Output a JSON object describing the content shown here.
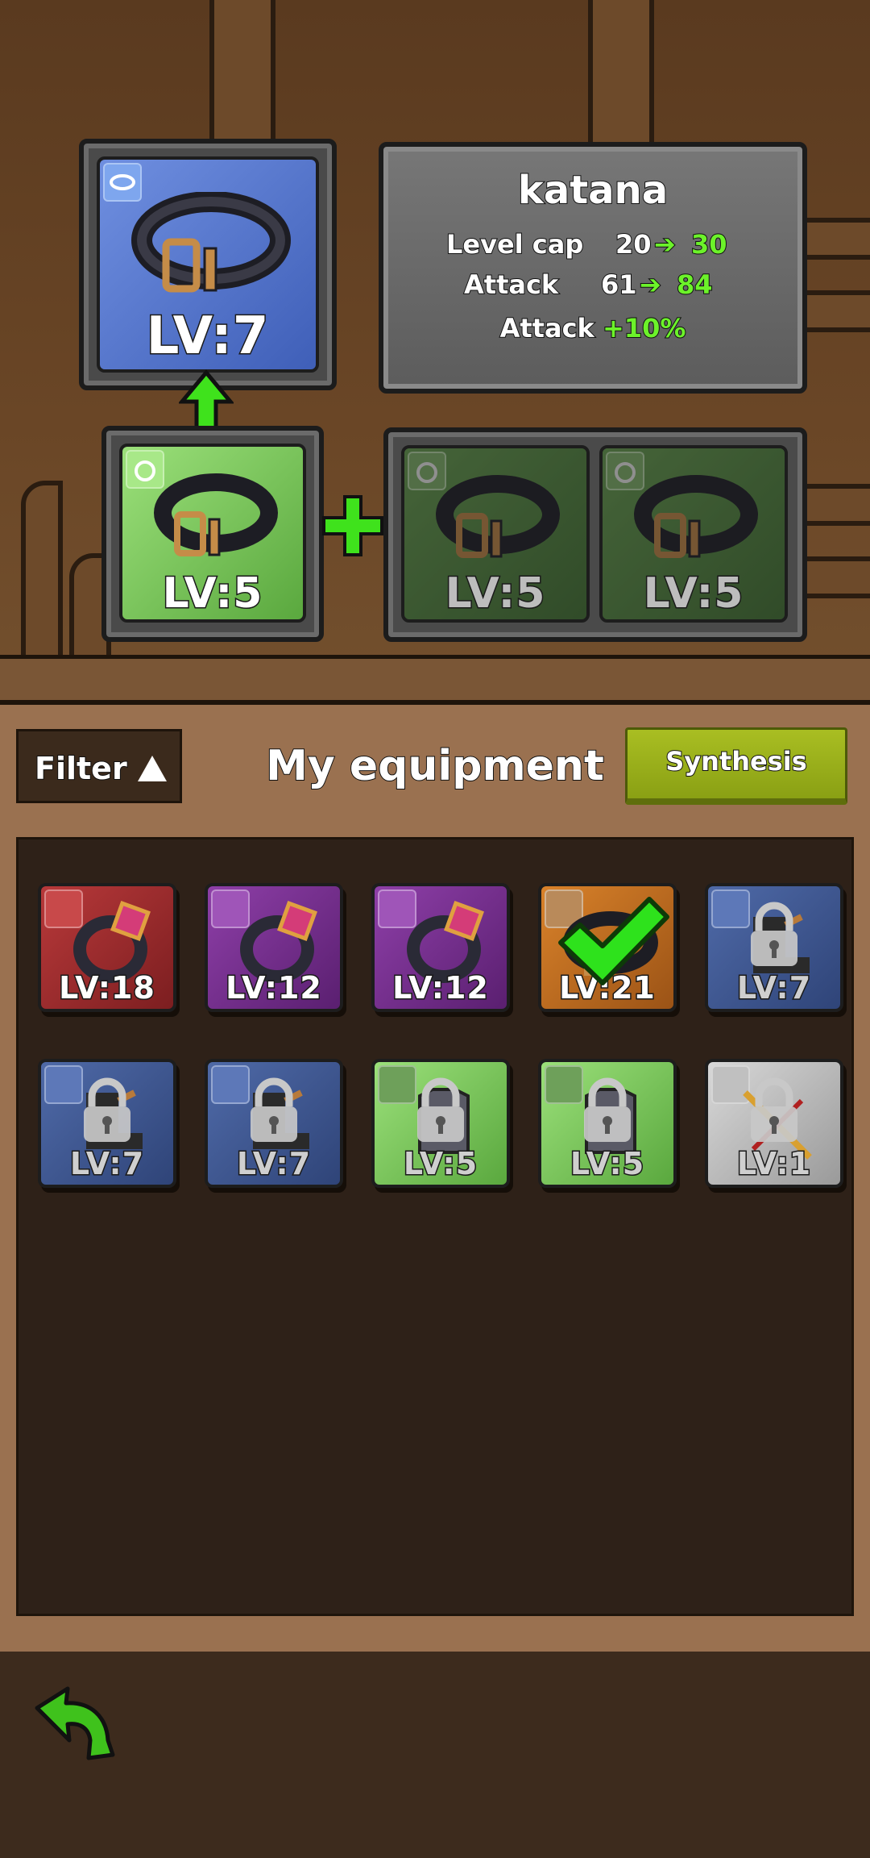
{
  "upgrade": {
    "target": {
      "level": "LV:7",
      "icon": "belt-icon",
      "slot_icon": "belt-slot-icon"
    },
    "source": {
      "level": "LV:5",
      "icon": "belt-icon",
      "slot_icon": "ring-slot-icon"
    },
    "materials": [
      {
        "level": "LV:5",
        "icon": "belt-icon"
      },
      {
        "level": "LV:5",
        "icon": "belt-icon"
      }
    ]
  },
  "stats": {
    "name": "katana",
    "rows": [
      {
        "label": "Level cap",
        "from": "20",
        "to": "30"
      },
      {
        "label": "Attack",
        "from": "61",
        "to": "84"
      }
    ],
    "bonus": {
      "label": "Attack",
      "value": "+10%"
    }
  },
  "toolbar": {
    "filter_label": "Filter",
    "title": "My equipment",
    "synthesis_label": "Synthesis"
  },
  "inventory": [
    {
      "level": "LV:18",
      "rarity": "red",
      "item": "ring-icon",
      "locked": false,
      "selected": false
    },
    {
      "level": "LV:12",
      "rarity": "purple",
      "item": "ring-icon",
      "locked": false,
      "selected": false
    },
    {
      "level": "LV:12",
      "rarity": "purple",
      "item": "ring-icon",
      "locked": false,
      "selected": false
    },
    {
      "level": "LV:21",
      "rarity": "orange",
      "item": "belt-icon",
      "locked": false,
      "selected": true
    },
    {
      "level": "LV:7",
      "rarity": "navy",
      "item": "boots-icon",
      "locked": true,
      "selected": false
    },
    {
      "level": "LV:7",
      "rarity": "navy",
      "item": "boots-icon",
      "locked": true,
      "selected": false
    },
    {
      "level": "LV:7",
      "rarity": "navy",
      "item": "boots-icon",
      "locked": true,
      "selected": false
    },
    {
      "level": "LV:5",
      "rarity": "green",
      "item": "armor-icon",
      "locked": true,
      "selected": false
    },
    {
      "level": "LV:5",
      "rarity": "green",
      "item": "armor-icon",
      "locked": true,
      "selected": false
    },
    {
      "level": "LV:1",
      "rarity": "gray",
      "item": "sword-icon",
      "locked": true,
      "selected": false
    }
  ],
  "colors": {
    "accent_green": "#6cf22a",
    "synthesis_button": "#9cb01c"
  }
}
